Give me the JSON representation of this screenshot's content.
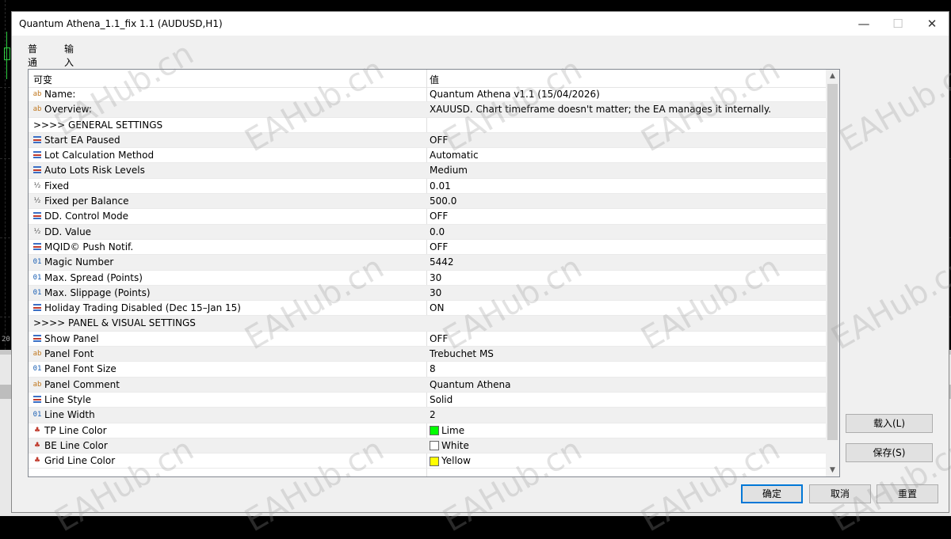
{
  "window": {
    "title": "Quantum Athena_1.1_fix 1.1 (AUDUSD,H1)",
    "min_glyph": "—",
    "max_glyph": "☐",
    "close_glyph": "✕"
  },
  "tabs": [
    {
      "label": "普通"
    },
    {
      "label": "输入"
    }
  ],
  "table": {
    "headers": {
      "name": "可变",
      "value": "值"
    },
    "rows": [
      {
        "icon": "ab",
        "name": "Name:",
        "value": "Quantum Athena v1.1 (15/04/2026)"
      },
      {
        "icon": "ab",
        "name": "Overview:",
        "value": "XAUUSD. Chart timeframe doesn't matter; the EA manages it internally."
      },
      {
        "icon": "",
        "name": ">>>> GENERAL SETTINGS",
        "value": ""
      },
      {
        "icon": "enum",
        "name": "Start EA Paused",
        "value": "OFF"
      },
      {
        "icon": "enum",
        "name": "Lot Calculation Method",
        "value": "Automatic"
      },
      {
        "icon": "enum",
        "name": "Auto Lots Risk Levels",
        "value": "Medium"
      },
      {
        "icon": "½",
        "name": "Fixed",
        "value": "0.01"
      },
      {
        "icon": "½",
        "name": "Fixed per Balance",
        "value": "500.0"
      },
      {
        "icon": "enum",
        "name": "DD. Control Mode",
        "value": "OFF"
      },
      {
        "icon": "½",
        "name": "DD. Value",
        "value": "0.0"
      },
      {
        "icon": "enum",
        "name": "MQID© Push Notif.",
        "value": "OFF"
      },
      {
        "icon": "01",
        "name": "Magic Number",
        "value": "5442"
      },
      {
        "icon": "01",
        "name": "Max. Spread (Points)",
        "value": "30"
      },
      {
        "icon": "01",
        "name": "Max. Slippage (Points)",
        "value": "30"
      },
      {
        "icon": "enum",
        "name": "Holiday Trading Disabled (Dec 15–Jan 15)",
        "value": "ON"
      },
      {
        "icon": "",
        "name": ">>>> PANEL & VISUAL SETTINGS",
        "value": ""
      },
      {
        "icon": "enum",
        "name": "Show Panel",
        "value": "OFF"
      },
      {
        "icon": "ab",
        "name": "Panel Font",
        "value": "Trebuchet MS"
      },
      {
        "icon": "01",
        "name": "Panel Font Size",
        "value": "8"
      },
      {
        "icon": "ab",
        "name": "Panel Comment",
        "value": "Quantum Athena"
      },
      {
        "icon": "enum",
        "name": "Line Style",
        "value": "Solid"
      },
      {
        "icon": "01",
        "name": "Line Width",
        "value": "2"
      },
      {
        "icon": "color",
        "name": "TP Line Color",
        "value": "Lime",
        "swatch": "#00ff00"
      },
      {
        "icon": "color",
        "name": "BE Line Color",
        "value": "White",
        "swatch": "#ffffff"
      },
      {
        "icon": "color",
        "name": "Grid Line Color",
        "value": "Yellow",
        "swatch": "#ffff00"
      }
    ]
  },
  "buttons": {
    "load": "载入(L)",
    "save": "保存(S)",
    "ok": "确定",
    "cancel": "取消",
    "reset": "重置"
  },
  "chart_tick": "20",
  "watermark": "EAHub.cn",
  "colors": {
    "accent": "#0078d7"
  }
}
